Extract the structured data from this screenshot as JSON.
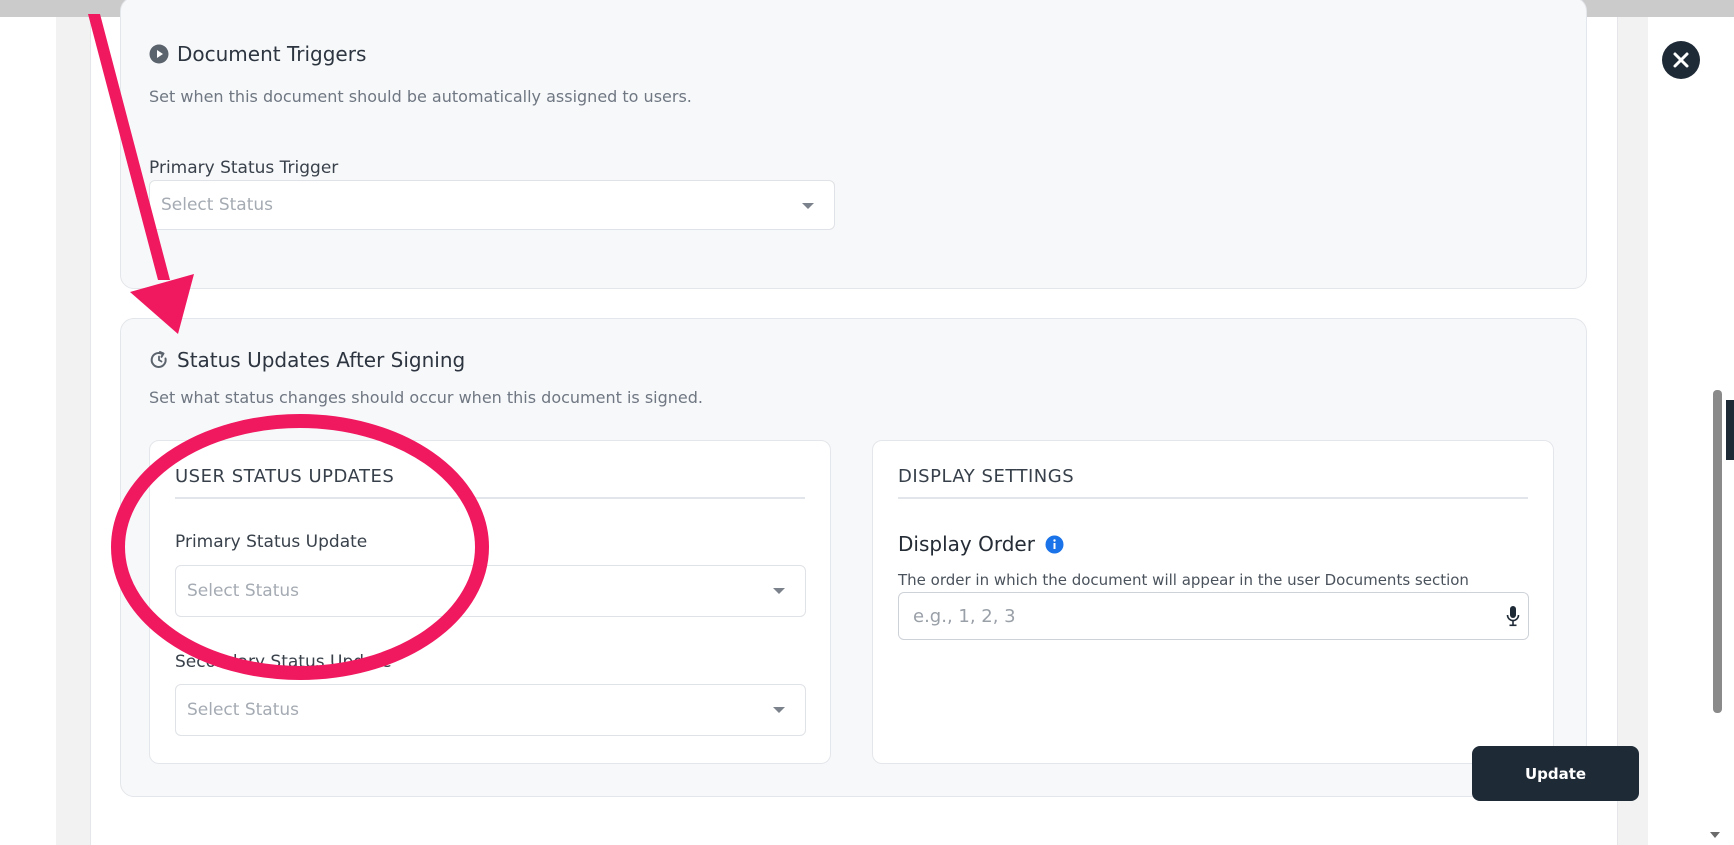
{
  "triggers": {
    "title": "Document Triggers",
    "description": "Set when this document should be automatically assigned to users.",
    "primary_label": "Primary Status Trigger",
    "primary_placeholder": "Select Status"
  },
  "after_signing": {
    "title": "Status Updates After Signing",
    "description": "Set what status changes should occur when this document is signed.",
    "user_updates": {
      "heading": "USER STATUS UPDATES",
      "primary_label": "Primary Status Update",
      "primary_placeholder": "Select Status",
      "secondary_label": "Secondary Status Update",
      "secondary_placeholder": "Select Status"
    },
    "display_settings": {
      "heading": "DISPLAY SETTINGS",
      "order_label": "Display Order",
      "order_help": "The order in which the document will appear in the user Documents section",
      "order_placeholder": "e.g., 1, 2, 3"
    }
  },
  "actions": {
    "update_label": "Update"
  },
  "colors": {
    "primary_dark": "#1f2a37",
    "info_blue": "#1a73e8",
    "annotation_pink": "#f0185e"
  },
  "icons": [
    "play-circle-icon",
    "refresh-clock-icon",
    "chevron-down-icon",
    "info-icon",
    "microphone-icon",
    "close-icon"
  ]
}
